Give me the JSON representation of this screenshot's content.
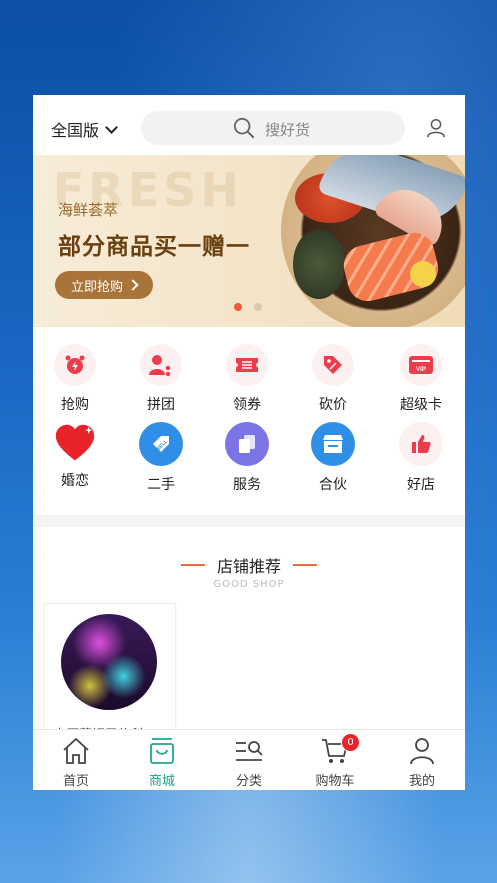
{
  "header": {
    "region": "全国版",
    "search_placeholder": "搜好货"
  },
  "banner": {
    "bg_word": "FRESH",
    "subtitle": "海鲜荟萃",
    "title": "部分商品买一赠一",
    "button": "立即抢购",
    "slides": 2,
    "active_slide": 1
  },
  "grid": {
    "row1": [
      "抢购",
      "拼团",
      "领券",
      "砍价",
      "超级卡"
    ],
    "row2": [
      "婚恋",
      "二手",
      "服务",
      "合伙",
      "好店"
    ]
  },
  "section": {
    "title": "店铺推荐",
    "subtitle": "GOOD SHOP"
  },
  "shop": {
    "name": "大厦菲妮民修科"
  },
  "tabbar": {
    "items": [
      "首页",
      "商城",
      "分类",
      "购物车",
      "我的"
    ],
    "active": "商城",
    "cart_count": "0"
  },
  "colors": {
    "accent": "#1aa88a",
    "banner_button": "#a8743a",
    "badge": "#e8232a",
    "icon_red": "#ef3c4a",
    "icon_blue": "#2f8fe6",
    "icon_purple": "#7b74e6"
  }
}
